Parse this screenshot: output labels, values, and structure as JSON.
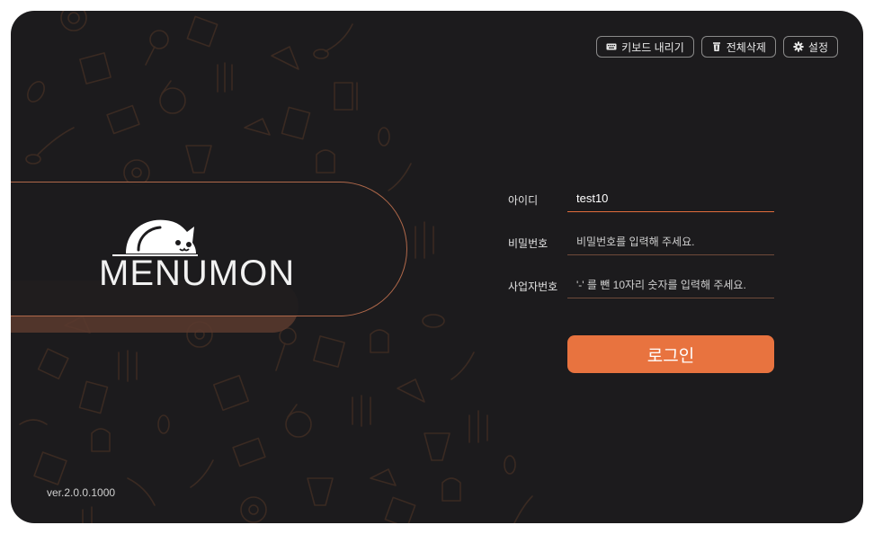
{
  "brand": {
    "name": "MENUMON"
  },
  "toolbar": {
    "keyboard_label": "키보드 내리기",
    "clear_label": "전체삭제",
    "settings_label": "설정"
  },
  "form": {
    "id_label": "아이디",
    "id_value": "test10",
    "password_label": "비밀번호",
    "password_placeholder": "비밀번호를 입력해 주세요.",
    "biz_label": "사업자번호",
    "biz_placeholder": "'-' 를 뺀 10자리 숫자를 입력해 주세요."
  },
  "login_label": "로그인",
  "version": "ver.2.0.0.1000",
  "colors": {
    "accent": "#e8733f",
    "background": "#1c1b1d",
    "pattern": "#3a2a22"
  }
}
